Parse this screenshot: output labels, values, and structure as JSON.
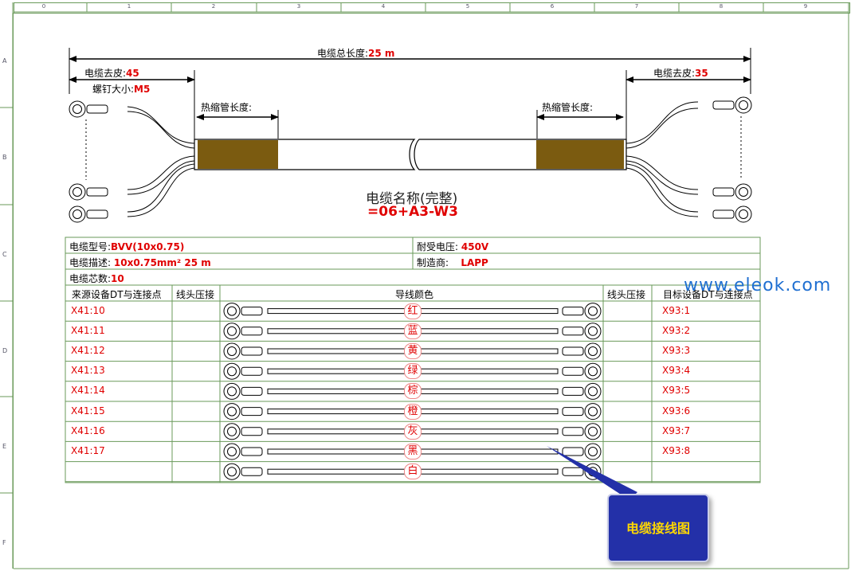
{
  "grid": {
    "columns": [
      "0",
      "1",
      "2",
      "3",
      "4",
      "5",
      "6",
      "7",
      "8",
      "9"
    ],
    "rows": [
      "A",
      "B",
      "C",
      "D",
      "E",
      "F"
    ]
  },
  "dims": {
    "total_label": "电缆总长度:",
    "total_value": "25 m",
    "strip_left_label": "电缆去皮:",
    "strip_left_value": "45",
    "strip_right_label": "电缆去皮:",
    "strip_right_value": "35",
    "screw_label": "螺钉大小:",
    "screw_value": "M5",
    "heatshrink_left": "热缩管长度:",
    "heatshrink_right": "热缩管长度:"
  },
  "cable_name": {
    "label": "电缆名称(完整)",
    "value": "=06+A3-W3"
  },
  "info": {
    "type_label": "电缆型号:",
    "type_value": "BVV(10x0.75)",
    "voltage_label": "耐受电压:",
    "voltage_value": "450V",
    "desc_label": "电缆描述:",
    "desc_value": "10x0.75mm² 25 m",
    "maker_label": "制造商:",
    "maker_value": "LAPP",
    "cores_label": "电缆芯数:",
    "cores_value": "10"
  },
  "table": {
    "headers": [
      "来源设备DT与连接点",
      "线头压接",
      "导线颜色",
      "线头压接",
      "目标设备DT与连接点"
    ],
    "rows": [
      {
        "src": "X41:10",
        "color": "红",
        "dst": "X93:1"
      },
      {
        "src": "X41:11",
        "color": "蓝",
        "dst": "X93:2"
      },
      {
        "src": "X41:12",
        "color": "黄",
        "dst": "X93:3"
      },
      {
        "src": "X41:13",
        "color": "绿",
        "dst": "X93:4"
      },
      {
        "src": "X41:14",
        "color": "棕",
        "dst": "X93:5"
      },
      {
        "src": "X41:15",
        "color": "橙",
        "dst": "X93:6"
      },
      {
        "src": "X41:16",
        "color": "灰",
        "dst": "X93:7"
      },
      {
        "src": "X41:17",
        "color": "黑",
        "dst": "X93:8"
      },
      {
        "src": "",
        "color": "白",
        "dst": ""
      }
    ]
  },
  "watermark": "www.eleok.com",
  "callout": "电缆接线图",
  "colors": {
    "frame": "#6a9a5a",
    "heatshrink": "#7b5b10",
    "accent_red": "#e00000",
    "callout_bg": "#2330a8",
    "callout_text": "#ffd800"
  }
}
